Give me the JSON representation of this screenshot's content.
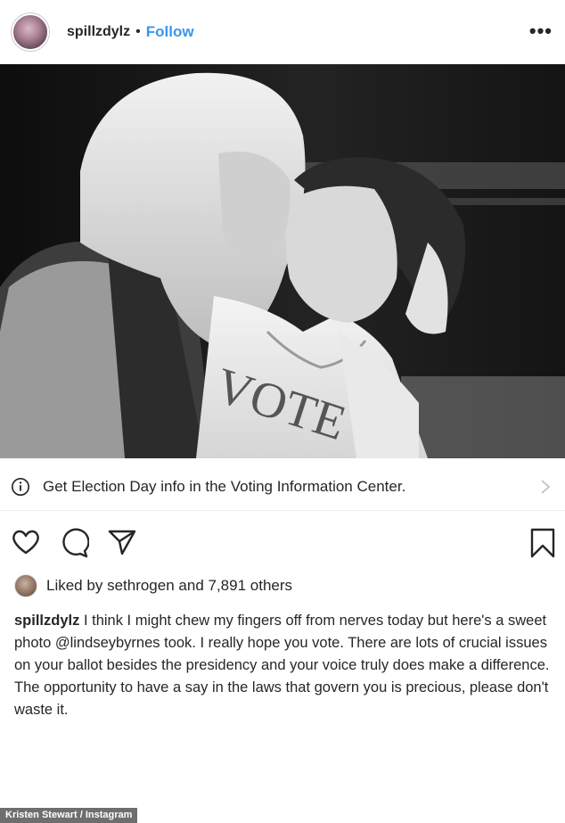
{
  "header": {
    "username": "spillzdylz",
    "separator": "•",
    "follow_label": "Follow",
    "more_icon": "more-options-icon"
  },
  "post": {
    "image_icon": "photo",
    "vote_banner": "Get Election Day info in the Voting Information Center.",
    "shirt_text": "VOTE"
  },
  "actions": {
    "like_icon": "heart-icon",
    "comment_icon": "comment-icon",
    "share_icon": "share-icon",
    "save_icon": "bookmark-icon"
  },
  "likes": {
    "prefix": "Liked by",
    "user": "sethrogen",
    "suffix": "and 7,891 others"
  },
  "caption": {
    "username": "spillzdylz",
    "part1": "I think I might chew my fingers off from nerves today but here's a sweet photo",
    "mention": "@lindseybyrnes",
    "part2": "took. I really hope you vote. There are lots of crucial issues on your ballot besides the presidency and your voice truly does make a difference. The opportunity to have a say in the laws that govern you is precious, please don't waste it."
  },
  "credit": "Kristen Stewart / Instagram"
}
